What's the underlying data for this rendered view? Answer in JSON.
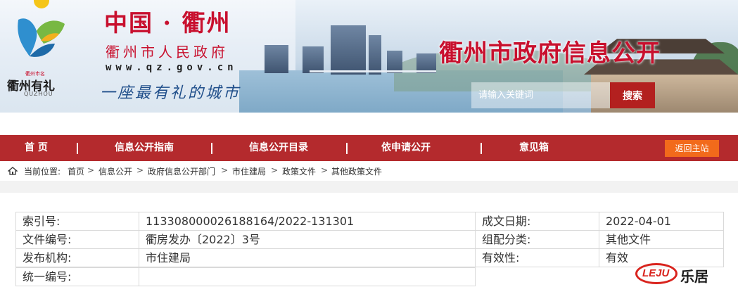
{
  "banner": {
    "logo_small": "衢州市名",
    "logo_brand": "衢州有礼",
    "logo_pinyin": "QUZHOU",
    "site_title": "中国 · 衢州",
    "site_sub": "衢州市人民政府",
    "site_url": "www.qz.gov.cn",
    "slogan": "一座最有礼的城市",
    "portal_title": "衢州市政府信息公开",
    "search_placeholder": "请输入关键词",
    "search_button": "搜索"
  },
  "nav": {
    "items": [
      {
        "label": "首  页"
      },
      {
        "label": "信息公开指南"
      },
      {
        "label": "信息公开目录"
      },
      {
        "label": "依申请公开"
      },
      {
        "label": "意见箱"
      }
    ],
    "home_link": "返回主站",
    "separator": "|"
  },
  "breadcrumb": {
    "label": "当前位置:",
    "items": [
      "首页",
      "信息公开",
      "政府信息公开部门",
      "市住建局",
      "政策文件",
      "其他政策文件"
    ],
    "separator": ">"
  },
  "info": {
    "rows": [
      {
        "k1": "索引号:",
        "v1": "113308000026188164/2022-131301",
        "k2": "成文日期:",
        "v2": "2022-04-01"
      },
      {
        "k1": "文件编号:",
        "v1": "衢房发办〔2022〕3号",
        "k2": "组配分类:",
        "v2": "其他文件"
      },
      {
        "k1": "发布机构:",
        "v1": "市住建局",
        "k2": "有效性:",
        "v2": "有效"
      },
      {
        "k1": "统一编号:",
        "v1": ""
      }
    ]
  },
  "watermark": {
    "logo": "LEJU",
    "text": "乐居"
  },
  "colors": {
    "nav_red": "#b42a2d",
    "title_red": "#c8102e",
    "home_orange": "#f26a1b",
    "search_red": "#b3201f"
  }
}
